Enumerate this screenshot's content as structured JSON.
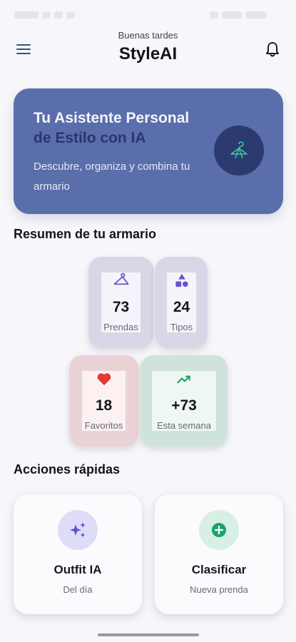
{
  "header": {
    "greeting": "Buenas tardes",
    "title": "StyleAI",
    "menu_icon": "menu-icon",
    "bell_icon": "bell-icon"
  },
  "hero": {
    "title_line1": "Tu Asistente Personal",
    "title_line2": "de Estilo con IA",
    "description": "Descubre, organiza y combina tu armario",
    "icon": "hanger-icon"
  },
  "summary": {
    "title": "Resumen de tu armario",
    "stats": [
      {
        "value": "73",
        "label": "Prendas",
        "icon": "hanger-icon",
        "color": "#5b4fcf"
      },
      {
        "value": "24",
        "label": "Tipos",
        "icon": "shapes-icon",
        "color": "#6b4fd6"
      },
      {
        "value": "18",
        "label": "Favoritos",
        "icon": "heart-icon",
        "color": "#e53935"
      },
      {
        "value": "+73",
        "label": "Esta semana",
        "icon": "trending-up-icon",
        "color": "#1aa36b"
      }
    ]
  },
  "actions": {
    "title": "Acciones rápidas",
    "items": [
      {
        "title": "Outfit IA",
        "subtitle": "Del día",
        "icon": "sparkles-icon"
      },
      {
        "title": "Clasificar",
        "subtitle": "Nueva prenda",
        "icon": "add-circle-icon"
      }
    ]
  },
  "colors": {
    "hero_bg": "#5a6eab",
    "hero_icon_bg": "#2b3b6f",
    "accent_primary": "#3b4f86",
    "accent_green": "#1aa36b",
    "accent_red": "#e53935"
  }
}
